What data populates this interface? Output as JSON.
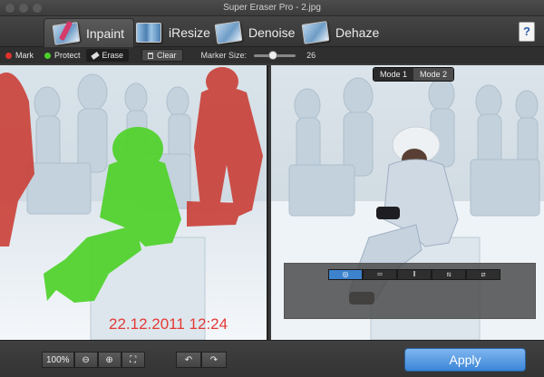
{
  "window": {
    "title": "Super Eraser Pro - 2.jpg"
  },
  "tabs": [
    {
      "label": "Inpaint",
      "icon": "inpaint-icon",
      "active": true
    },
    {
      "label": "iResize",
      "icon": "resize-icon",
      "active": false
    },
    {
      "label": "Denoise",
      "icon": "denoise-icon",
      "active": false
    },
    {
      "label": "Dehaze",
      "icon": "dehaze-icon",
      "active": false
    }
  ],
  "help": {
    "label": "?"
  },
  "brush": {
    "mark": "Mark",
    "protect": "Protect",
    "erase": "Erase",
    "clear": "Clear",
    "marker_size_label": "Marker Size:",
    "marker_size_value": "26",
    "marker_size_fraction": 0.45,
    "colors": {
      "mark": "#e0322d",
      "protect": "#4cd02a"
    }
  },
  "preview": {
    "modes": [
      "Mode 1",
      "Mode 2"
    ],
    "active_mode": "Mode 1",
    "compare_buttons": [
      "◎",
      "═",
      "‖",
      "⧅",
      "⧄"
    ],
    "active_compare": 0
  },
  "image": {
    "date_stamp": "22.12.2011 12:24"
  },
  "bottom": {
    "zoom": "100%",
    "zoom_out": "⊖",
    "zoom_in": "⊕",
    "fit": "⛶",
    "undo": "↶",
    "redo": "↷",
    "apply": "Apply"
  }
}
